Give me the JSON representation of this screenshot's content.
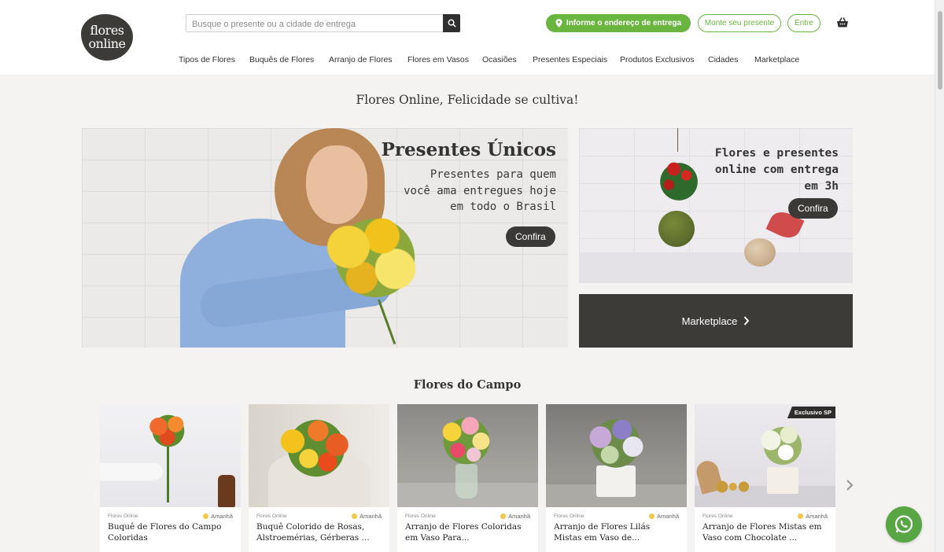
{
  "header": {
    "logo_line1": "flores",
    "logo_line2": "online",
    "search_placeholder": "Busque o presente ou a cidade de entrega",
    "address_button": "Informe o endereço de entrega",
    "build_gift_button": "Monte seu presente",
    "login_button": "Entre"
  },
  "nav": {
    "items": [
      "Tipos de Flores",
      "Buquês de Flores",
      "Arranjo de Flores",
      "Flores em Vasos",
      "Ocasiões",
      "Presentes Especiais",
      "Produtos Exclusivos",
      "Cidades",
      "Marketplace"
    ]
  },
  "tagline": "Flores Online, Felicidade se cultiva!",
  "banner_main": {
    "title": "Presentes Únicos",
    "subtitle": "Presentes para quem você ama entregues hoje em todo o Brasil",
    "cta": "Confira"
  },
  "banner_side": {
    "text": "Flores e presentes online com entrega em 3h",
    "cta": "Confira"
  },
  "marketplace_button": "Marketplace",
  "section": {
    "title": "Flores do Campo",
    "products": [
      {
        "brand": "Flores Online",
        "delivery": "Amanhã",
        "title": "Buquê de Flores do Campo Coloridas",
        "badge": ""
      },
      {
        "brand": "Flores Online",
        "delivery": "Amanhã",
        "title": "Buquê Colorido de Rosas, Alstroemérias, Gérberas ...",
        "badge": ""
      },
      {
        "brand": "Flores Online",
        "delivery": "Amanhã",
        "title": "Arranjo de Flores Coloridas em Vaso Para...",
        "badge": ""
      },
      {
        "brand": "Flores Online",
        "delivery": "Amanhã",
        "title": "Arranjo de Flores Lilás Mistas em Vaso de...",
        "badge": ""
      },
      {
        "brand": "Flores Online",
        "delivery": "Amanhã",
        "title": "Arranjo de Flores Mistas em Vaso com Chocolate ...",
        "badge": "Exclusivo SP"
      }
    ]
  },
  "colors": {
    "accent_green": "#6ab540",
    "dark": "#3d3b38",
    "whatsapp": "#58a543"
  }
}
